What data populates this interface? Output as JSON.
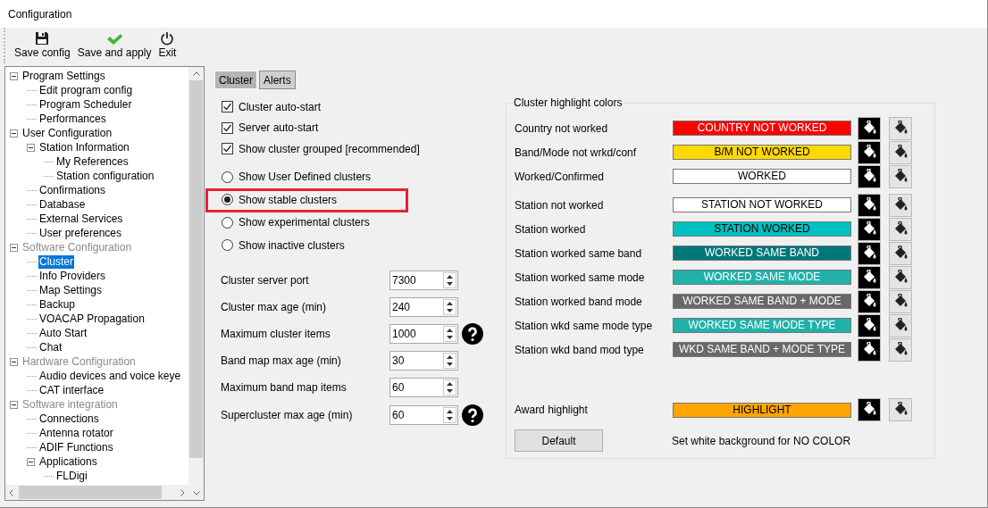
{
  "window": {
    "title": "Configuration"
  },
  "toolbar": [
    {
      "kind": "save",
      "label": "Save config"
    },
    {
      "kind": "apply",
      "label": "Save and apply"
    },
    {
      "kind": "exit",
      "label": "Exit"
    }
  ],
  "tree": [
    {
      "label": "Program Settings",
      "expanded": true,
      "disabled": false,
      "selected": false,
      "children": [
        {
          "label": "Edit program config",
          "disabled": false,
          "selected": false
        },
        {
          "label": "Program Scheduler",
          "disabled": false,
          "selected": false
        },
        {
          "label": "Performances",
          "disabled": false,
          "selected": false
        }
      ]
    },
    {
      "label": "User Configuration",
      "expanded": true,
      "disabled": false,
      "selected": false,
      "children": [
        {
          "label": "Station Information",
          "expanded": true,
          "disabled": false,
          "selected": false,
          "children": [
            {
              "label": "My References",
              "disabled": false,
              "selected": false
            },
            {
              "label": "Station configuration",
              "disabled": false,
              "selected": false
            }
          ]
        },
        {
          "label": "Confirmations",
          "disabled": false,
          "selected": false
        },
        {
          "label": "Database",
          "disabled": false,
          "selected": false
        },
        {
          "label": "External Services",
          "disabled": false,
          "selected": false
        },
        {
          "label": "User preferences",
          "disabled": false,
          "selected": false
        }
      ]
    },
    {
      "label": "Software Configuration",
      "expanded": true,
      "disabled": true,
      "selected": false,
      "children": [
        {
          "label": "Cluster",
          "selected": true
        },
        {
          "label": "Info Providers",
          "disabled": false,
          "selected": false
        },
        {
          "label": "Map Settings",
          "disabled": false,
          "selected": false
        },
        {
          "label": "Backup",
          "disabled": false,
          "selected": false
        },
        {
          "label": "VOACAP Propagation",
          "disabled": false,
          "selected": false
        },
        {
          "label": "Auto Start",
          "disabled": false,
          "selected": false
        },
        {
          "label": "Chat",
          "disabled": false,
          "selected": false
        }
      ]
    },
    {
      "label": "Hardware Configuration",
      "expanded": true,
      "disabled": true,
      "selected": false,
      "children": [
        {
          "label": "Audio devices and voice keye",
          "disabled": false,
          "selected": false
        },
        {
          "label": "CAT interface",
          "disabled": false,
          "selected": false
        }
      ]
    },
    {
      "label": "Software integration",
      "expanded": true,
      "disabled": true,
      "selected": false,
      "children": [
        {
          "label": "Connections",
          "disabled": false,
          "selected": false
        },
        {
          "label": "Antenna rotator",
          "disabled": false,
          "selected": false
        },
        {
          "label": "ADIF Functions",
          "disabled": false,
          "selected": false
        },
        {
          "label": "Applications",
          "expanded": true,
          "disabled": false,
          "selected": false,
          "children": [
            {
              "label": "FLDigi",
              "disabled": false,
              "selected": false
            }
          ]
        }
      ]
    }
  ],
  "tabs": [
    {
      "label": "Cluster",
      "selected": true
    },
    {
      "label": "Alerts",
      "selected": false
    }
  ],
  "checkboxes": [
    {
      "label": "Cluster auto-start",
      "checked": true
    },
    {
      "label": "Server auto-start",
      "checked": true
    },
    {
      "label": "Show cluster grouped [recommended]",
      "checked": true
    }
  ],
  "radios": [
    {
      "label": "Show User Defined clusters",
      "selected": false,
      "highlighted": false
    },
    {
      "label": "Show stable clusters",
      "selected": true,
      "highlighted": true
    },
    {
      "label": "Show experimental clusters",
      "selected": false,
      "highlighted": false
    },
    {
      "label": "Show inactive clusters",
      "selected": false,
      "highlighted": false
    }
  ],
  "fields": [
    {
      "label": "Cluster server port",
      "value": "7300",
      "help": false
    },
    {
      "label": "Cluster max age (min)",
      "value": "240",
      "help": false
    },
    {
      "label": "Maximum cluster items",
      "value": "1000",
      "help": true
    },
    {
      "label": "Band map max age (min)",
      "value": "30",
      "help": false
    },
    {
      "label": "Maximum band map items",
      "value": "60",
      "help": false
    },
    {
      "label": "Supercluster max age (min)",
      "value": "60",
      "help": true
    }
  ],
  "highlight_colors": {
    "title": "Cluster highlight colors",
    "rows": [
      {
        "label": "Country not worked",
        "sample": "COUNTRY NOT WORKED",
        "color": "#ff0000",
        "light_text": true
      },
      {
        "label": "Band/Mode not wrkd/conf",
        "sample": "B/M NOT WORKED",
        "color": "#ffd800",
        "light_text": false
      },
      {
        "label": "Worked/Confirmed",
        "sample": "WORKED",
        "color": "#ffffff",
        "light_text": false
      },
      {
        "label": "Station not worked",
        "sample": "STATION NOT WORKED",
        "color": "#ffffff",
        "light_text": false
      },
      {
        "label": "Station worked",
        "sample": "STATION WORKED",
        "color": "#00c0c0",
        "light_text": false
      },
      {
        "label": "Station worked same band",
        "sample": "WORKED SAME BAND",
        "color": "#00777a",
        "light_text": true
      },
      {
        "label": "Station worked same mode",
        "sample": "WORKED SAME MODE",
        "color": "#20b2aa",
        "light_text": true
      },
      {
        "label": "Station worked band mode",
        "sample": "WORKED SAME BAND + MODE",
        "color": "#696969",
        "light_text": true
      },
      {
        "label": "Station wkd same mode type",
        "sample": "WORKED SAME MODE TYPE",
        "color": "#20b2aa",
        "light_text": true
      },
      {
        "label": "Station wkd band mod type",
        "sample": "WKD SAME BAND + MODE TYPE",
        "color": "#696969",
        "light_text": true
      }
    ],
    "award": {
      "label": "Award highlight",
      "sample": "HIGHLIGHT",
      "color": "#ffa500",
      "light_text": false
    },
    "default_button": "Default",
    "note": "Set white background for NO COLOR"
  }
}
